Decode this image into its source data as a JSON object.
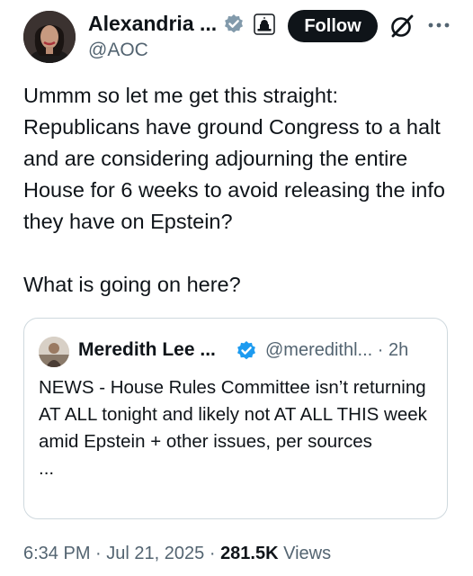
{
  "author": {
    "name": "Alexandria ...",
    "handle": "@AOC"
  },
  "actions": {
    "follow_label": "Follow"
  },
  "tweet": {
    "paragraph1": "Ummm so let me get this straight: Republicans have ground Congress to a halt and are considering adjourning the entire House for 6 weeks to avoid releasing the info they have on Epstein?",
    "paragraph2": "What is going on here?"
  },
  "quoted_tweet": {
    "name": "Meredith Lee ...",
    "handle": "@meredithl...",
    "separator": "·",
    "time": "2h",
    "text": "NEWS - House Rules Committee isn’t returning AT ALL tonight and likely not AT ALL THIS week amid Epstein + other issues, per sources",
    "ellipsis": "..."
  },
  "meta": {
    "time": "6:34 PM",
    "sep1": "·",
    "date": "Jul 21, 2025",
    "sep2": "·",
    "views_count": "281.5K",
    "views_label": "Views"
  },
  "colors": {
    "verified_gray": "#829aab",
    "verified_blue": "#1d9bf0",
    "text_primary": "#0f1419",
    "text_secondary": "#536471",
    "border": "#cfd9de"
  },
  "icons": {
    "verified_gray": "verified-gray-badge-icon",
    "government": "capitol-building-icon",
    "grok": "grok-icon",
    "more": "more-dots-icon",
    "verified_blue": "verified-blue-badge-icon"
  }
}
